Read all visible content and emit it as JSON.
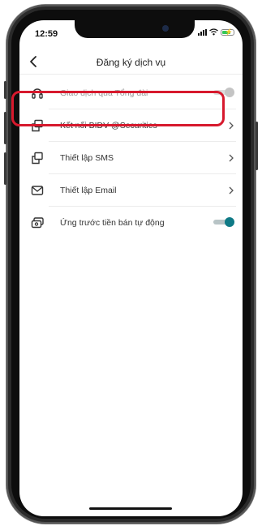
{
  "status_bar": {
    "time": "12:59"
  },
  "header": {
    "title": "Đăng ký dịch vụ"
  },
  "items": [
    {
      "label": "Giao dịch qua Tổng đài",
      "icon": "headset-icon",
      "control": "toggle",
      "enabled": false,
      "toggle_on": true
    },
    {
      "label": "Kết nối BIDV @Securities",
      "icon": "link-device-icon",
      "control": "chevron",
      "enabled": true,
      "highlighted": true
    },
    {
      "label": "Thiết lập SMS",
      "icon": "link-device-icon",
      "control": "chevron",
      "enabled": true
    },
    {
      "label": "Thiết lập Email",
      "icon": "envelope-icon",
      "control": "chevron",
      "enabled": true
    },
    {
      "label": "Ứng trước tiền bán tự động",
      "icon": "cards-icon",
      "control": "toggle",
      "enabled": true,
      "toggle_on": true
    }
  ],
  "colors": {
    "accent": "#0f7a86",
    "highlight_border": "#d7192d",
    "toggle_disabled_track": "#dcdcdc",
    "toggle_disabled_knob": "#c4c4c4",
    "toggle_active_track": "#b8c4c6"
  }
}
